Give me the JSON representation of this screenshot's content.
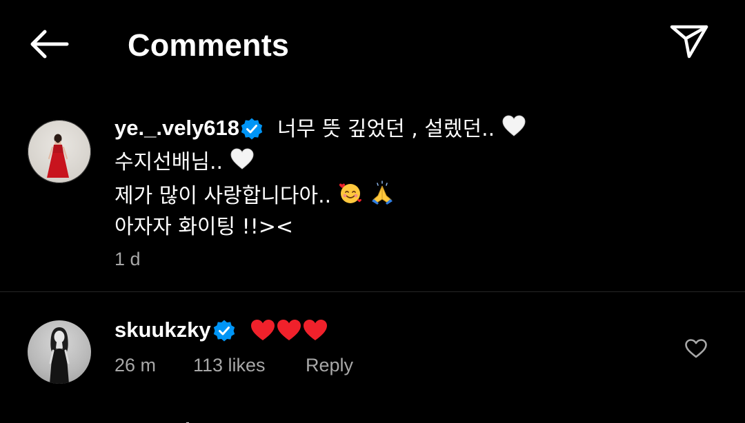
{
  "header": {
    "title": "Comments",
    "back_icon": "arrow-left-icon",
    "share_icon": "paper-plane-icon"
  },
  "comments": [
    {
      "username": "ye._.vely618",
      "verified": true,
      "lines": [
        "너무 뜻 깊었던 , 설렜던..",
        "수지선배님..",
        "제가 많이 사랑합니다아..",
        "아자자 화이팅 !!><"
      ],
      "emojis": [
        "white-heart",
        "white-heart",
        "smiling-face-with-hearts",
        "folded-hands"
      ],
      "time": "1 d"
    },
    {
      "username": "skuukzky",
      "verified": true,
      "text_emojis": [
        "red-heart",
        "red-heart",
        "red-heart"
      ],
      "time": "26 m",
      "likes": "113 likes",
      "reply": "Reply",
      "like_icon": "heart-outline-icon"
    }
  ],
  "colors": {
    "background": "#000000",
    "text": "#ffffff",
    "meta": "#a8a8a8",
    "verified_blue": "#0095f6",
    "divider": "#262626",
    "red_heart": "#f0212b"
  }
}
